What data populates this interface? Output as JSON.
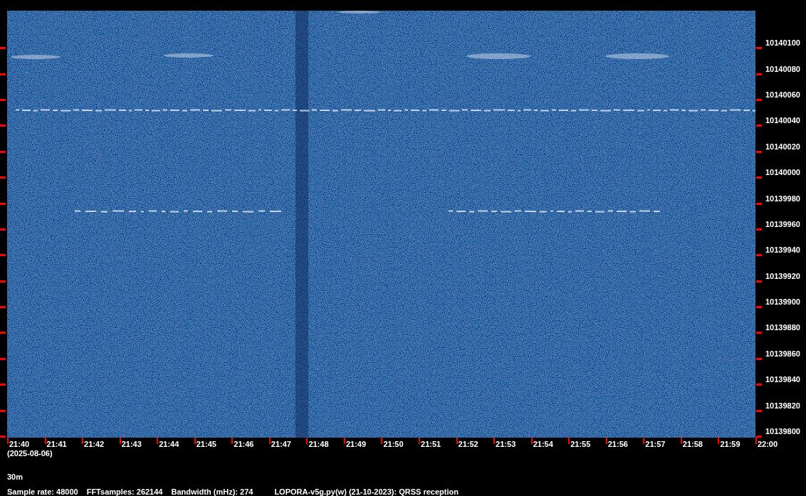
{
  "frequency_labels": [
    "10140100",
    "10140080",
    "10140060",
    "10140040",
    "10140020",
    "10140000",
    "10139980",
    "10139960",
    "10139940",
    "10139920",
    "10139900",
    "10139880",
    "10139860",
    "10139840",
    "10139820",
    "10139800"
  ],
  "time_labels": [
    "21:40",
    "21:41",
    "21:42",
    "21:43",
    "21:44",
    "21:45",
    "21:46",
    "21:47",
    "21:48",
    "21:49",
    "21:50",
    "21:51",
    "21:52",
    "21:53",
    "21:54",
    "21:55",
    "21:56",
    "21:57",
    "21:58",
    "21:59",
    "22:00"
  ],
  "date": "(2025-08-06)",
  "band": "30m",
  "info": [
    "Sample rate: 48000",
    "FFTsamples: 262144",
    "Bandwidth (mHz): 274",
    "LOPORA-v5g.py(w) (21-10-2023): QRSS reception"
  ]
}
